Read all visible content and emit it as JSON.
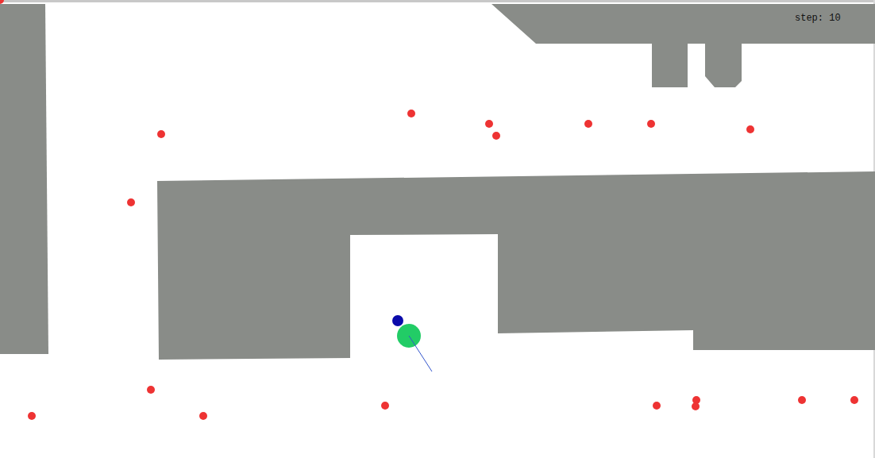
{
  "hud": {
    "step": "step: 10"
  },
  "agents": [
    {
      "kind": "robot",
      "color": "#22cc66"
    },
    {
      "kind": "goal",
      "color": "#0a0aaa"
    },
    {
      "kind": "pedestrian",
      "color": "#ee3333"
    },
    {
      "kind": "pedestrian",
      "color": "#ee3333"
    },
    {
      "kind": "pedestrian",
      "color": "#ee3333"
    },
    {
      "kind": "pedestrian",
      "color": "#ee3333"
    },
    {
      "kind": "pedestrian",
      "color": "#ee3333"
    },
    {
      "kind": "pedestrian",
      "color": "#ee3333"
    },
    {
      "kind": "pedestrian",
      "color": "#ee3333"
    },
    {
      "kind": "pedestrian",
      "color": "#ee3333"
    },
    {
      "kind": "pedestrian",
      "color": "#ee3333"
    },
    {
      "kind": "pedestrian",
      "color": "#ee3333"
    },
    {
      "kind": "pedestrian",
      "color": "#ee3333"
    },
    {
      "kind": "pedestrian",
      "color": "#ee3333"
    },
    {
      "kind": "pedestrian",
      "color": "#ee3333"
    },
    {
      "kind": "pedestrian",
      "color": "#ee3333"
    },
    {
      "kind": "pedestrian",
      "color": "#ee3333"
    },
    {
      "kind": "pedestrian",
      "color": "#ee3333"
    },
    {
      "kind": "pedestrian",
      "color": "#ee3333"
    },
    {
      "kind": "pedestrian",
      "color": "#ee3333"
    }
  ]
}
